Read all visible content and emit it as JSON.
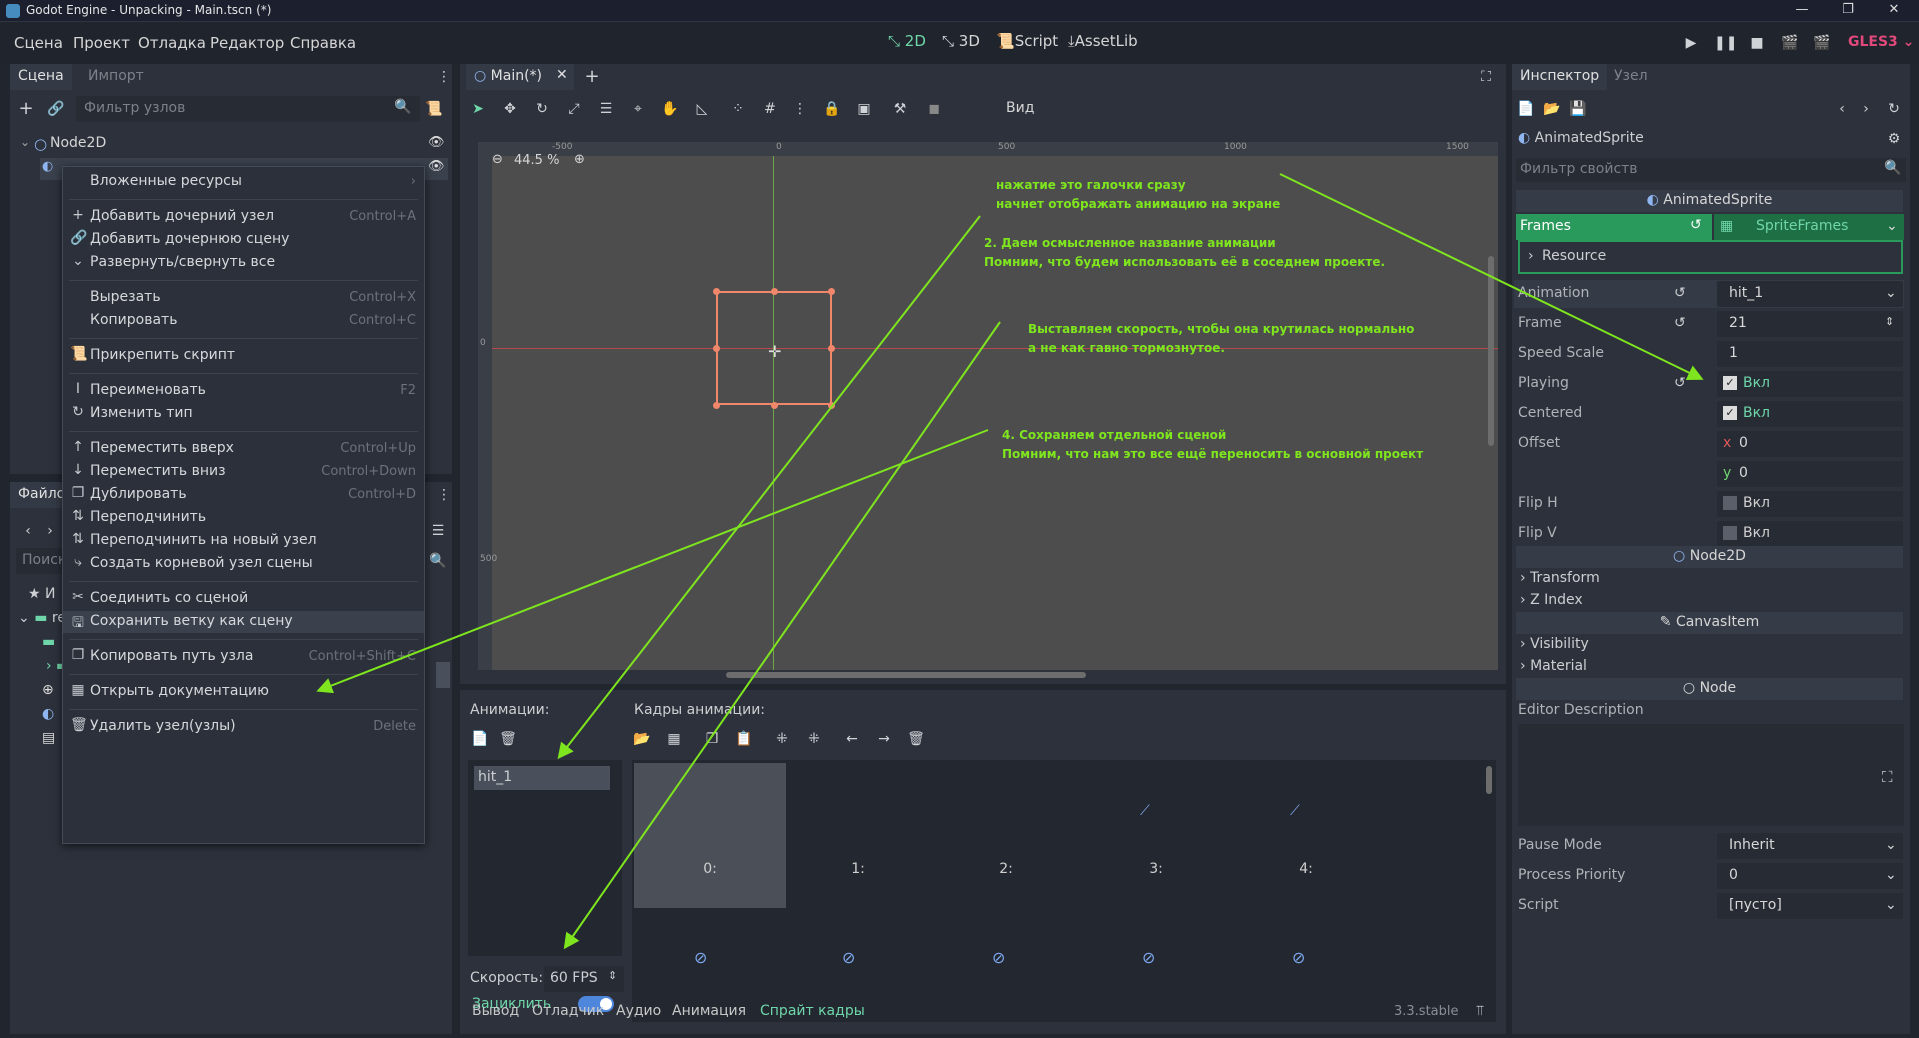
{
  "window": {
    "title": "Godot Engine - Unpacking - Main.tscn (*)",
    "controls": [
      "—",
      "❐",
      "✕"
    ]
  },
  "menu": [
    "Сцена",
    "Проект",
    "Отладка",
    "Редактор",
    "Справка"
  ],
  "workspaces": [
    {
      "label": "2D",
      "icon": "2d-icon",
      "active": true
    },
    {
      "label": "3D",
      "icon": "3d-icon",
      "active": false
    },
    {
      "label": "Script",
      "icon": "script-icon",
      "active": false
    },
    {
      "label": "AssetLib",
      "icon": "assetlib-icon",
      "active": false
    }
  ],
  "renderer": "GLES3",
  "scene_dock": {
    "tabs": [
      "Сцена",
      "Импорт"
    ],
    "filter_placeholder": "Фильтр узлов",
    "root_node": "Node2D"
  },
  "filesystem_dock": {
    "tab": "Файло",
    "search_placeholder": "Поиск",
    "rows": [
      "И",
      "re"
    ]
  },
  "context_menu": [
    {
      "type": "item",
      "label": "Вложенные ресурсы",
      "shortcut": "›",
      "icon": ""
    },
    {
      "type": "sep"
    },
    {
      "type": "item",
      "label": "Добавить дочерний узел",
      "shortcut": "Control+A",
      "icon": "+"
    },
    {
      "type": "item",
      "label": "Добавить дочернюю сцену",
      "shortcut": "",
      "icon": "🔗"
    },
    {
      "type": "item",
      "label": "Развернуть/свернуть все",
      "shortcut": "",
      "icon": "⌄"
    },
    {
      "type": "sep"
    },
    {
      "type": "item",
      "label": "Вырезать",
      "shortcut": "Control+X",
      "icon": ""
    },
    {
      "type": "item",
      "label": "Копировать",
      "shortcut": "Control+C",
      "icon": ""
    },
    {
      "type": "sep"
    },
    {
      "type": "item",
      "label": "Прикрепить скрипт",
      "shortcut": "",
      "icon": "📜"
    },
    {
      "type": "sep"
    },
    {
      "type": "item",
      "label": "Переименовать",
      "shortcut": "F2",
      "icon": "I"
    },
    {
      "type": "item",
      "label": "Изменить тип",
      "shortcut": "",
      "icon": "↻"
    },
    {
      "type": "sep"
    },
    {
      "type": "item",
      "label": "Переместить вверх",
      "shortcut": "Control+Up",
      "icon": "↑"
    },
    {
      "type": "item",
      "label": "Переместить вниз",
      "shortcut": "Control+Down",
      "icon": "↓"
    },
    {
      "type": "item",
      "label": "Дублировать",
      "shortcut": "Control+D",
      "icon": "❐"
    },
    {
      "type": "item",
      "label": "Переподчинить",
      "shortcut": "",
      "icon": "⇅"
    },
    {
      "type": "item",
      "label": "Переподчинить на новый узел",
      "shortcut": "",
      "icon": "⇅"
    },
    {
      "type": "item",
      "label": "Создать корневой узел сцены",
      "shortcut": "",
      "icon": "⤷"
    },
    {
      "type": "sep"
    },
    {
      "type": "item",
      "label": "Соединить со сценой",
      "shortcut": "",
      "icon": "✂"
    },
    {
      "type": "item",
      "label": "Сохранить ветку как сцену",
      "shortcut": "",
      "icon": "🖫",
      "highlight": true
    },
    {
      "type": "sep"
    },
    {
      "type": "item",
      "label": "Копировать путь узла",
      "shortcut": "Control+Shift+C",
      "icon": "❐"
    },
    {
      "type": "sep"
    },
    {
      "type": "item",
      "label": "Открыть документацию",
      "shortcut": "",
      "icon": "▦"
    },
    {
      "type": "sep"
    },
    {
      "type": "item",
      "label": "Удалить узел(узлы)",
      "shortcut": "Delete",
      "icon": "🗑"
    }
  ],
  "editor": {
    "tab": "Main(*)",
    "toolbar_view": "Вид",
    "zoom": "44.5 %",
    "ruler_labels": [
      "-500",
      "0",
      "500",
      "1000",
      "1500"
    ],
    "vruler_labels": [
      "0",
      "500"
    ]
  },
  "annotations": [
    {
      "lines": [
        "нажатие это галочки сразу",
        "начнет отображать анимацию на экране"
      ]
    },
    {
      "lines": [
        "2. Даем осмысленное название анимации",
        "Помним, что будем использовать её в соседнем проекте."
      ]
    },
    {
      "lines": [
        "Выставляем скорость, чтобы она крутилась нормально",
        "а не как гавно тормознутое."
      ]
    },
    {
      "lines": [
        "4. Сохраняем отдельной сценой",
        "Помним, что нам это все ещё переносить в основной проект"
      ]
    }
  ],
  "anim_panel": {
    "animations_label": "Анимации:",
    "frames_label": "Кадры анимации:",
    "animation_name": "hit_1",
    "speed_label": "Скорость:",
    "speed_value": "60 FPS",
    "loop_label": "Зациклить",
    "frame_numbers": [
      "0:",
      "1:",
      "2:",
      "3:",
      "4:"
    ]
  },
  "bottom_tabs": [
    "Вывод",
    "Отладчик",
    "Аудио",
    "Анимация",
    "Спрайт кадры"
  ],
  "version": "3.3.stable",
  "inspector": {
    "tabs": [
      "Инспектор",
      "Узел"
    ],
    "object_name": "AnimatedSprite",
    "filter_placeholder": "Фильтр свойств",
    "class_header": "AnimatedSprite",
    "frames_label": "Frames",
    "frames_value": "SpriteFrames",
    "resource_label": "Resource",
    "props": [
      {
        "label": "Animation",
        "value": "hit_1",
        "kind": "select"
      },
      {
        "label": "Frame",
        "value": "21",
        "kind": "spin"
      },
      {
        "label": "Speed Scale",
        "value": "1",
        "kind": "text"
      },
      {
        "label": "Playing",
        "value": "Вкл",
        "kind": "check_on"
      },
      {
        "label": "Centered",
        "value": "Вкл",
        "kind": "check_on"
      },
      {
        "label": "Offset",
        "value": "0",
        "kind": "vec_x"
      },
      {
        "label": "",
        "value": "0",
        "kind": "vec_y"
      },
      {
        "label": "Flip H",
        "value": "Вкл",
        "kind": "check_off"
      },
      {
        "label": "Flip V",
        "value": "Вкл",
        "kind": "check_off"
      }
    ],
    "node2d_header": "Node2D",
    "node2d_items": [
      "Transform",
      "Z Index"
    ],
    "canvasitem_header": "CanvasItem",
    "canvasitem_items": [
      "Visibility",
      "Material"
    ],
    "node_header": "Node",
    "editor_description": "Editor Description",
    "bottom_props": [
      {
        "label": "Pause Mode",
        "value": "Inherit"
      },
      {
        "label": "Process Priority",
        "value": "0"
      },
      {
        "label": "Script",
        "value": "[пусто]"
      }
    ]
  },
  "colors": {
    "accent": "#6fd6a9",
    "annotation": "#7ee51e",
    "selection_box": "#f0876b",
    "frames_row": "#2a9a5c"
  }
}
